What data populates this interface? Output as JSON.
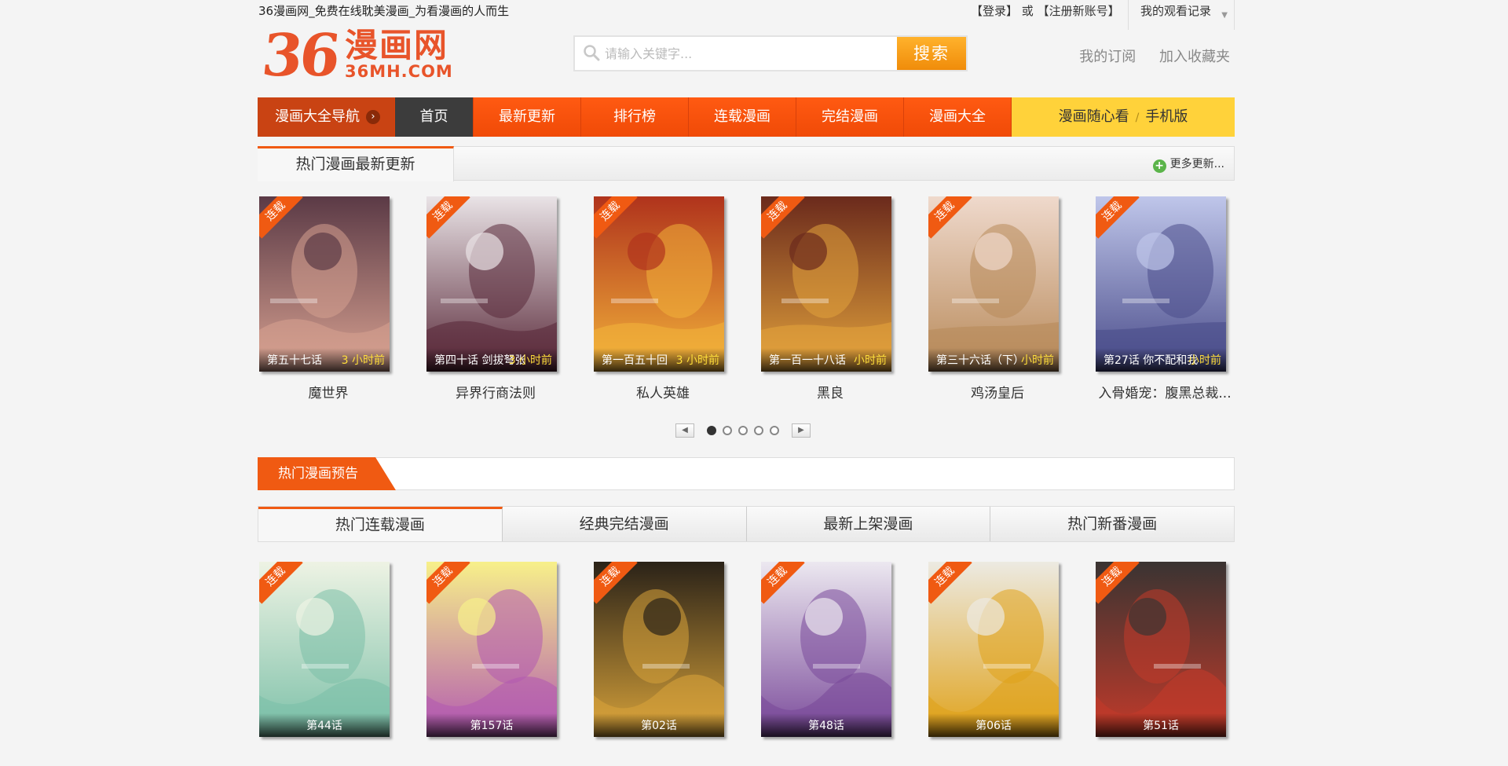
{
  "topbar": {
    "tagline": "36漫画网_免费在线耽美漫画_为看漫画的人而生",
    "login": "【登录】",
    "or": "或",
    "register": "【注册新账号】",
    "history": "我的观看记录"
  },
  "logo": {
    "num": "36",
    "cn": "漫画网",
    "en": "36MH.COM"
  },
  "search": {
    "placeholder": "请输入关键字...",
    "button": "搜索"
  },
  "header_links": {
    "subscribe": "我的订阅",
    "favorite": "加入收藏夹"
  },
  "nav": {
    "guide": "漫画大全导航",
    "home": "首页",
    "items": [
      "最新更新",
      "排行榜",
      "连载漫画",
      "完结漫画",
      "漫画大全"
    ],
    "mobile_a": "漫画随心看",
    "mobile_sep": "/",
    "mobile_b": "手机版"
  },
  "hot_section": {
    "title": "热门漫画最新更新",
    "more": "更多更新..."
  },
  "hot_comics": [
    {
      "badge": "连载",
      "chapter": "第五十七话",
      "time": "3 小时前",
      "title": "魔世界",
      "bg": "#5b3a46",
      "accent": "#d6a090"
    },
    {
      "badge": "连载",
      "chapter": "第四十话 剑拔弩张",
      "time": "3 小时前",
      "title": "异界行商法则",
      "bg": "#e9e3e6",
      "accent": "#5a2a3a"
    },
    {
      "badge": "连载",
      "chapter": "第一百五十回",
      "time": "3 小时前",
      "title": "私人英雄",
      "bg": "#b0331c",
      "accent": "#f2b23a"
    },
    {
      "badge": "连载",
      "chapter": "第一百一十八话",
      "time": "小时前",
      "title": "黑良",
      "bg": "#6b2a1c",
      "accent": "#e2a23c"
    },
    {
      "badge": "连载",
      "chapter": "第三十六话（下）",
      "time": "小时前",
      "title": "鸡汤皇后",
      "bg": "#efd9cc",
      "accent": "#b88a5a"
    },
    {
      "badge": "连载",
      "chapter": "第27话 你不配和我",
      "time": "小时前",
      "title": "入骨婚宠：腹黑总裁...",
      "bg": "#bfc6ea",
      "accent": "#4a4c8a"
    }
  ],
  "pager": {
    "prev": "◀",
    "next": "▶",
    "pages": 5,
    "active": 1
  },
  "preview": {
    "title": "热门漫画预告"
  },
  "tabs": [
    "热门连载漫画",
    "经典完结漫画",
    "最新上架漫画",
    "热门新番漫画"
  ],
  "tab_comics": [
    {
      "badge": "连载",
      "chapter": "第44话",
      "bg": "#eef3e4",
      "accent": "#7cc0a8"
    },
    {
      "badge": "连载",
      "chapter": "第157话",
      "bg": "#f7f08a",
      "accent": "#b35ab0"
    },
    {
      "badge": "连载",
      "chapter": "第02话",
      "bg": "#2a2218",
      "accent": "#d7a23a"
    },
    {
      "badge": "连载",
      "chapter": "第48话",
      "bg": "#ece8f0",
      "accent": "#7a4a9a"
    },
    {
      "badge": "连载",
      "chapter": "第06话",
      "bg": "#eceae2",
      "accent": "#e0a21a"
    },
    {
      "badge": "连载",
      "chapter": "第51话",
      "bg": "#3a3432",
      "accent": "#c33a2a"
    }
  ]
}
